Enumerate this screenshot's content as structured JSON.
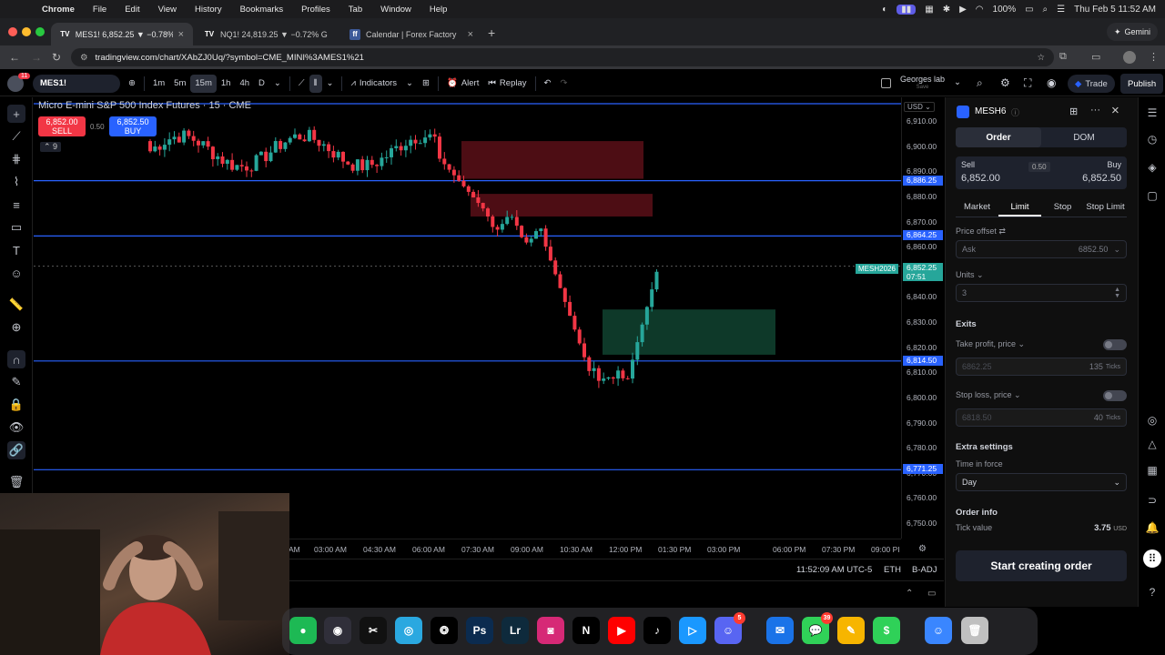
{
  "menubar": {
    "app": "Chrome",
    "items": [
      "File",
      "Edit",
      "View",
      "History",
      "Bookmarks",
      "Profiles",
      "Tab",
      "Window",
      "Help"
    ],
    "battery": "100%",
    "clock": "Thu Feb 5  11:52 AM"
  },
  "browser": {
    "tabs": [
      {
        "label": "MES1! 6,852.25 ▼ −0.78% G",
        "active": true
      },
      {
        "label": "NQ1! 24,819.25 ▼ −0.72% G",
        "active": false
      },
      {
        "label": "Calendar | Forex Factory",
        "active": false
      }
    ],
    "gemini": "Gemini",
    "url": "tradingview.com/chart/XAbZJ0Uq/?symbol=CME_MINI%3AMES1%21"
  },
  "toolbar": {
    "symbol": "MES1!",
    "notif_count": "11",
    "intervals": [
      "1m",
      "5m",
      "15m",
      "1h",
      "4h",
      "D"
    ],
    "selected_interval": "15m",
    "indicators": "Indicators",
    "alert": "Alert",
    "replay": "Replay",
    "layout_name": "Georges lab",
    "layout_sub": "Save",
    "trade": "Trade",
    "publish": "Publish"
  },
  "legend": {
    "title": "Micro E-mini S&P 500 Index Futures · 15 · CME",
    "sell_price": "6,852.00",
    "sell_label": "SELL",
    "spread": "0.50",
    "buy_price": "6,852.50",
    "buy_label": "BUY",
    "count": "9"
  },
  "price_axis": {
    "currency": "USD",
    "ticks": [
      "6,910.00",
      "6,900.00",
      "6,890.00",
      "6,880.00",
      "6,870.00",
      "6,860.00",
      "6,850.00",
      "6,840.00",
      "6,830.00",
      "6,820.00",
      "6,810.00",
      "6,800.00",
      "6,790.00",
      "6,780.00",
      "6,770.00",
      "6,760.00",
      "6,750.00"
    ],
    "levels": [
      "6,886.25",
      "6,864.25",
      "6,814.50",
      "6,771.25"
    ],
    "last_price": "6,852.25",
    "countdown": "07:51",
    "symbol_tag": "MESH2026",
    "colors": {
      "level": "#2962ff",
      "last": "#26a69a",
      "up": "#26a69a",
      "down": "#f23645"
    }
  },
  "time_axis": {
    "labels": [
      "AM",
      "03:00 AM",
      "04:30 AM",
      "06:00 AM",
      "07:30 AM",
      "09:00 AM",
      "10:30 AM",
      "12:00 PM",
      "01:30 PM",
      "03:00 PM",
      "06:00 PM",
      "07:30 PM",
      "09:00 PI"
    ]
  },
  "status_bar": {
    "clock": "11:52:09 AM UTC-5",
    "session": "ETH",
    "adj": "B-ADJ"
  },
  "order_panel": {
    "symbol": "MESH6",
    "tabs": [
      "Order",
      "DOM"
    ],
    "sell_label": "Sell",
    "sell_price": "6,852.00",
    "spread": "0.50",
    "buy_label": "Buy",
    "buy_price": "6,852.50",
    "order_types": [
      "Market",
      "Limit",
      "Stop",
      "Stop Limit"
    ],
    "selected_type": "Limit",
    "price_offset_label": "Price offset",
    "price_offset_field": "Ask",
    "price_offset_value": "6852.50",
    "units_label": "Units",
    "units_value": "3",
    "exits_label": "Exits",
    "take_profit_label": "Take profit, price",
    "take_profit_value": "6862.25",
    "take_profit_ticks": "135",
    "ticks_unit": "Ticks",
    "stop_loss_label": "Stop loss, price",
    "stop_loss_value": "6818.50",
    "stop_loss_ticks": "40",
    "extra_label": "Extra settings",
    "tif_label": "Time in force",
    "tif_value": "Day",
    "info_label": "Order info",
    "tick_value_label": "Tick value",
    "tick_value": "3.75",
    "tick_currency": "USD",
    "start_button": "Start creating order"
  },
  "dock": {
    "apps": [
      "Spotify",
      "OBS",
      "CapCut",
      "Safari",
      "ChatGPT",
      "Photoshop",
      "Lightroom",
      "Instagram",
      "Netflix",
      "YouTube",
      "TikTok",
      "Prime Video",
      "Discord",
      "Mail",
      "Messages",
      "Notes",
      "Robinhood",
      "Finder",
      "Trash"
    ],
    "discord_badge": "5",
    "messages_badge": "39"
  }
}
